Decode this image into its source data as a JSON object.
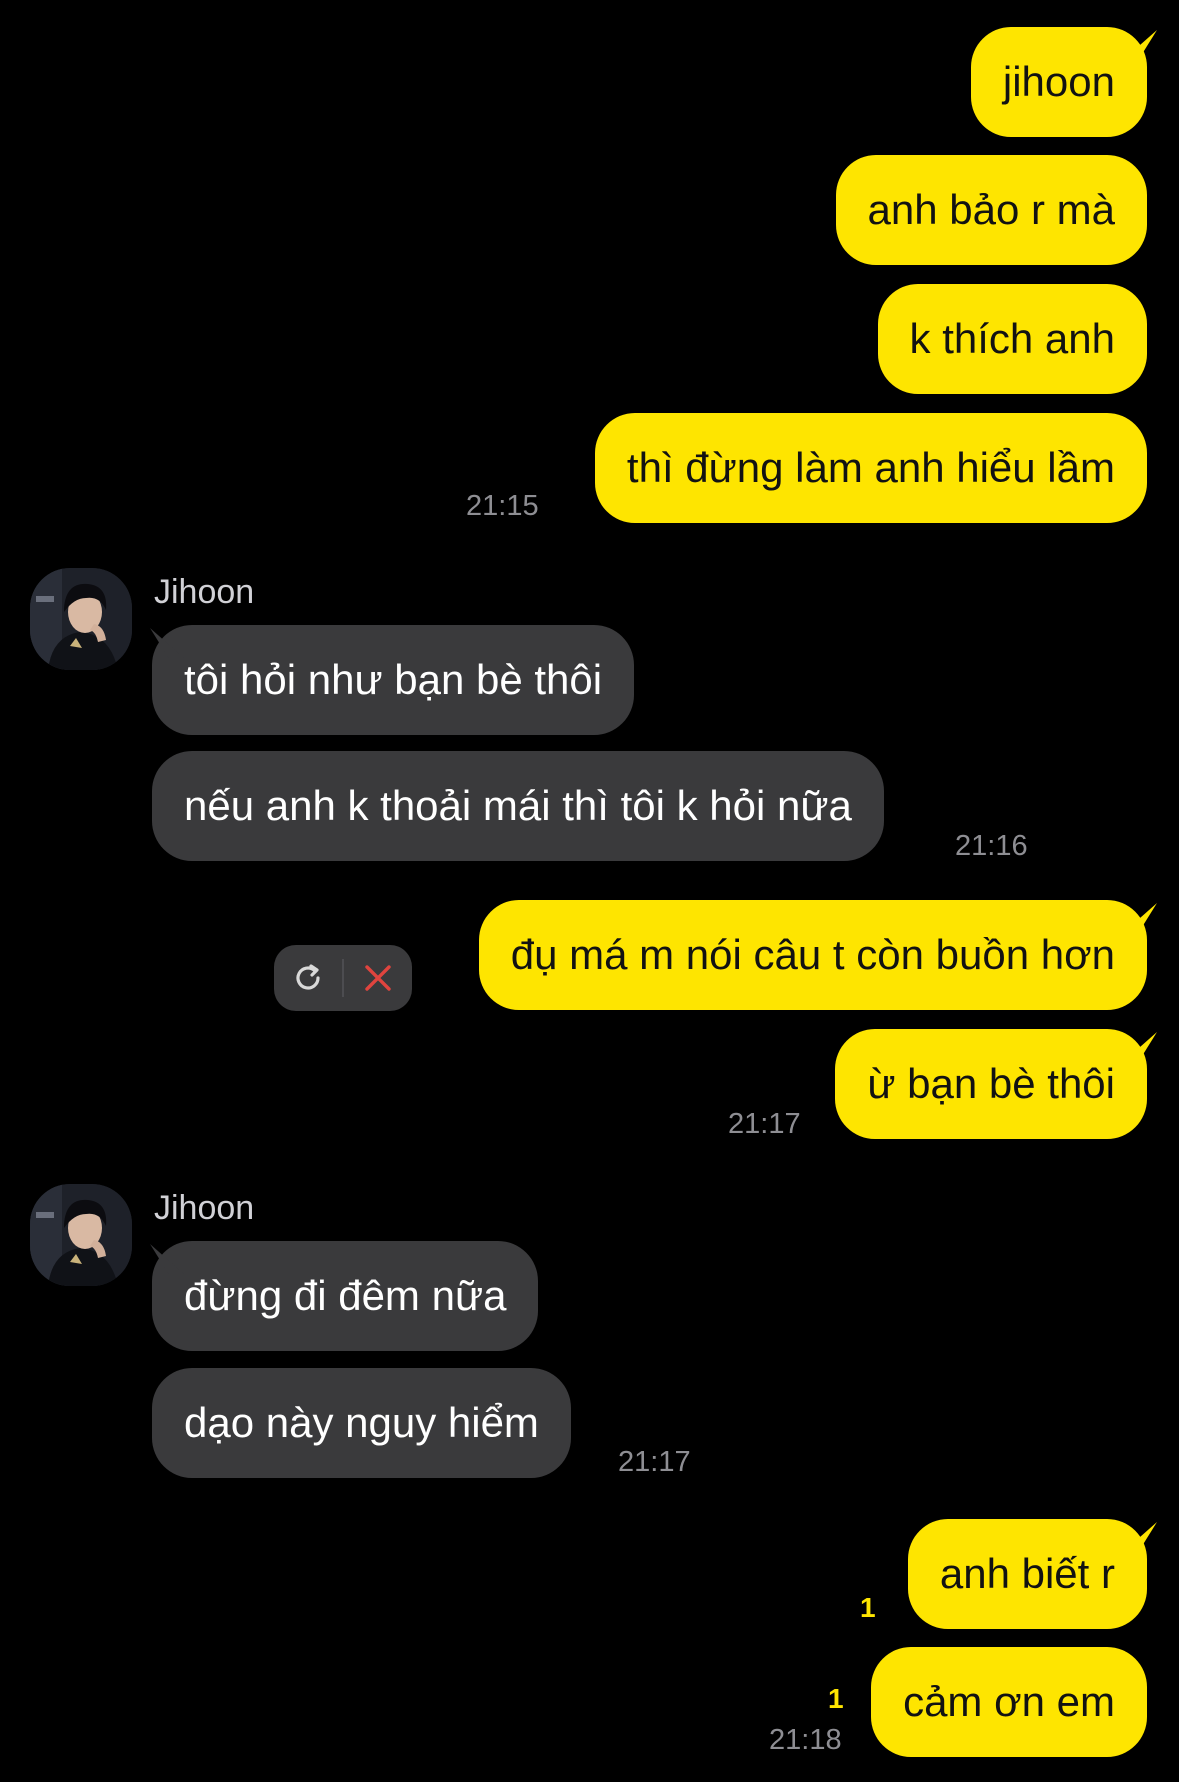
{
  "colors": {
    "background": "#000000",
    "my_bubble": "#FEE500",
    "their_bubble": "#3A3A3C",
    "timestamp": "#8E8E93",
    "unread": "#FEE500",
    "delete_icon": "#E0443E"
  },
  "messages": {
    "m1": "jihoon",
    "m2": "anh bảo r mà",
    "m3": "k thích anh",
    "m4": "thì đừng làm anh hiểu lầm",
    "m5": "tôi hỏi như bạn bè thôi",
    "m6": "nếu anh k thoải mái thì tôi k hỏi nữa",
    "m7": "đụ má m nói câu t còn buồn hơn",
    "m8": "ừ bạn bè thôi",
    "m9": "đừng đi đêm nữa",
    "m10": "dạo này nguy hiểm",
    "m11": "anh biết r",
    "m12": "cảm ơn em"
  },
  "times": {
    "t1": "21:15",
    "t2": "21:16",
    "t3": "21:17",
    "t4": "21:17",
    "t5": "21:18"
  },
  "senders": {
    "g1": "Jihoon",
    "g2": "Jihoon"
  },
  "unread": {
    "u1": "1",
    "u2": "1"
  },
  "failed_message_actions": {
    "retry_icon": "refresh-icon",
    "delete_icon": "close-x-icon"
  }
}
